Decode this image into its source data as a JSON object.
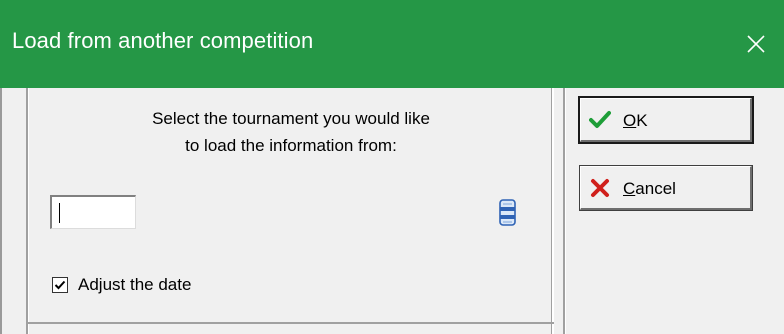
{
  "window": {
    "title": "Load from another competition",
    "close_symbol": "✕"
  },
  "main": {
    "instruction_line1": "Select the tournament you would like",
    "instruction_line2": "to load the information from:",
    "tournament_input": {
      "value": ""
    },
    "lookup_icon": "list-lookup-icon",
    "adjust_date": {
      "label": "Adjust the date",
      "checked": true
    }
  },
  "buttons": {
    "ok": {
      "mnemonic": "O",
      "rest": "K",
      "icon": "green-checkmark-icon",
      "is_default": true
    },
    "cancel": {
      "mnemonic": "C",
      "rest": "ancel",
      "icon": "red-x-icon"
    }
  },
  "colors": {
    "titlebar": "#259746",
    "title_text": "#ffffff",
    "check_green": "#1e9e38",
    "cancel_red": "#d0201c",
    "lookup_blue": "#2f63b5"
  }
}
